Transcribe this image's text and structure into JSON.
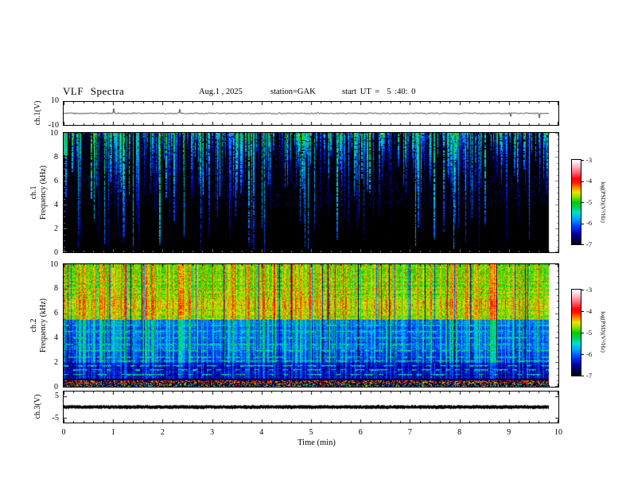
{
  "header": {
    "title": "VLF Spectra",
    "date": "Aug.1 , 2025",
    "station": "station=GAK",
    "start_ut": "start UT =  5 :40: 0"
  },
  "x_axis": {
    "label": "Time (min)",
    "ticks": [
      "0",
      "1",
      "2",
      "3",
      "4",
      "5",
      "6",
      "7",
      "8",
      "9",
      "10"
    ],
    "range_min": 0,
    "range_max": 10
  },
  "panels": {
    "ch1_wave": {
      "ylabel": "ch.1(V)",
      "ytick_top": "10",
      "ytick_bottom": "-10",
      "y_min": -10,
      "y_max": 10
    },
    "ch1_spec": {
      "ylabel_channel": "ch.1",
      "ylabel_axis": "Frequency (kHz)",
      "yticks": [
        "10",
        "8",
        "6",
        "4",
        "2",
        "0"
      ],
      "y_min": 0,
      "y_max": 10
    },
    "ch2_spec": {
      "ylabel_channel": "ch.2",
      "ylabel_axis": "Frequency (kHz)",
      "yticks": [
        "10",
        "8",
        "6",
        "4",
        "2",
        "0"
      ],
      "y_min": 0,
      "y_max": 10
    },
    "ch3_wave": {
      "ylabel": "ch.3(V)",
      "ytick_top": "5",
      "ytick_bottom": "-5",
      "y_min": -7,
      "y_max": 7
    }
  },
  "colorbars": [
    {
      "label": "log(PSD)(V²/Hz)",
      "ticks": [
        "-3",
        "-4",
        "-5",
        "-6",
        "-7"
      ],
      "v_top": -3,
      "v_bottom": -7
    },
    {
      "label": "log(PSD)(V²/Hz)",
      "ticks": [
        "-3",
        "-4",
        "-5",
        "-6",
        "-7"
      ],
      "v_top": -3,
      "v_bottom": -7
    }
  ],
  "chart_data": {
    "type": "heatmap",
    "title": "VLF Spectra",
    "date": "Aug.1 , 2025",
    "station": "GAK",
    "start_ut": "5:40:0",
    "x": {
      "label": "Time (min)",
      "min": 0,
      "max": 10,
      "data_end_min": 9.8,
      "major_tick_step": 1,
      "minor_tick_step": 0.2
    },
    "panels": [
      {
        "name": "ch.1(V)",
        "type": "waveform",
        "y_min": -10,
        "y_max": 10,
        "description": "thin noisy trace near 0 V with sparse small spikes, data ends at 9.8 min"
      },
      {
        "name": "ch.1 spectrogram",
        "type": "spectrogram",
        "y_label": "Frequency (kHz)",
        "y_min": 0,
        "y_max": 10,
        "background_psd": -7,
        "description": "black background with dense vertical blue/cyan sferic streaks descending from 10 kHz, denser above 5 kHz, occasional bright green streaks reaching 0 kHz, cyan patch at left edge near 10 kHz"
      },
      {
        "name": "ch.2 spectrogram",
        "type": "spectrogram",
        "y_label": "Frequency (kHz)",
        "y_min": 0,
        "y_max": 10,
        "bands": [
          {
            "f_range": [
              5.5,
              10
            ],
            "psd_approx": -4.8,
            "appearance": "green-yellow, brighter yellow around 6-7 kHz, red specks above 6 kHz, thin red and dark vertical lines"
          },
          {
            "f_range": [
              2.0,
              5.5
            ],
            "psd_approx": -6.0,
            "appearance": "blue with many cyan/green vertical streaks and intermittent horizontal cyan-green hiss lines"
          },
          {
            "f_range": [
              0.7,
              2.0
            ],
            "psd_approx": -6.5,
            "appearance": "dark navy with intermittent bright green horizontal lines near 1.0-1.8 kHz"
          },
          {
            "f_range": [
              0.0,
              0.7
            ],
            "psd_approx": -6.9,
            "appearance": "near black with red/pink speckle row near 0.3-0.5 kHz and multicolor speckle rows at bottom"
          }
        ]
      },
      {
        "name": "ch.3(V)",
        "type": "waveform",
        "y_min": -7,
        "y_max": 7,
        "description": "thick flat black trace at 0 V ending at 9.8 min"
      }
    ],
    "colorbar": {
      "label": "log(PSD)(V²/Hz)",
      "min": -7,
      "max": -3,
      "tick_values": [
        -3,
        -4,
        -5,
        -6,
        -7
      ]
    },
    "colormap_stops": [
      [
        "#000000",
        0.0
      ],
      [
        "#000050",
        0.06
      ],
      [
        "#0000a0",
        0.13
      ],
      [
        "#0040ff",
        0.22
      ],
      [
        "#00a0ff",
        0.3
      ],
      [
        "#00e0d0",
        0.38
      ],
      [
        "#00d060",
        0.44
      ],
      [
        "#00cc00",
        0.5
      ],
      [
        "#80e000",
        0.56
      ],
      [
        "#e8e800",
        0.62
      ],
      [
        "#ff8000",
        0.68
      ],
      [
        "#ff2000",
        0.73
      ],
      [
        "#ff0000",
        0.78
      ],
      [
        "#ff6070",
        0.85
      ],
      [
        "#ffb0c0",
        0.92
      ],
      [
        "#ffffff",
        1.0
      ]
    ]
  }
}
